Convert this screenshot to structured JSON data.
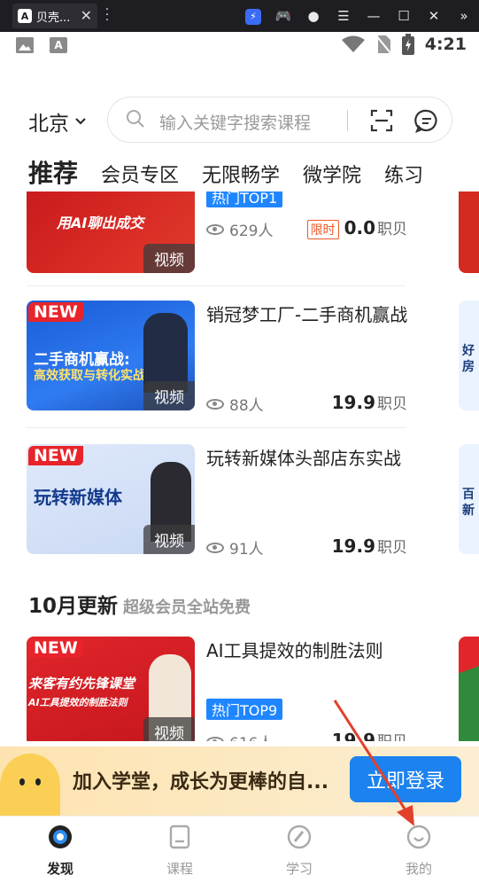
{
  "window": {
    "tab_title": "贝壳...",
    "app_logo": "A",
    "icons": [
      "flash-icon",
      "gamepad-icon",
      "account-icon",
      "menu-icon",
      "minimize-icon",
      "maximize-icon",
      "close-icon",
      "collapse-icon"
    ]
  },
  "status": {
    "time": "4:21"
  },
  "search": {
    "city": "北京",
    "placeholder": "输入关键字搜索课程"
  },
  "tabs": [
    "推荐",
    "会员专区",
    "无限畅学",
    "微学院",
    "练习"
  ],
  "courses": [
    {
      "thumb_caption": "用AI聊出成交",
      "video_label": "视频",
      "badge": "热门TOP1",
      "views": "629人",
      "limited": "限时",
      "price": "0.0",
      "unit": "职贝"
    },
    {
      "new": "NEW",
      "thumb_line1": "二手商机赢战:",
      "thumb_line2": "高效获取与转化实战",
      "video_label": "视频",
      "title": "销冠梦工厂-二手商机赢战",
      "views": "88人",
      "price": "19.9",
      "unit": "职贝"
    },
    {
      "new": "NEW",
      "thumb_line1": "玩转新媒体",
      "video_label": "视频",
      "title": "玩转新媒体头部店东实战",
      "views": "91人",
      "price": "19.9",
      "unit": "职贝"
    }
  ],
  "section": {
    "title": "10月更新",
    "subtitle": "超级会员全站免费"
  },
  "october": {
    "new": "NEW",
    "thumb_line1": "来客有约先锋课堂",
    "thumb_line2": "AI工具提效的制胜法则",
    "video_label": "视频",
    "title": "AI工具提效的制胜法则",
    "badge": "热门TOP9",
    "views": "616人",
    "price": "19.9",
    "unit": "职贝"
  },
  "peek": {
    "line1": "好",
    "line2": "房",
    "line3": "百",
    "line4": "新"
  },
  "banner": {
    "text": "加入学堂，成长为更棒的自...",
    "button": "立即登录"
  },
  "nav": [
    "发现",
    "课程",
    "学习",
    "我的"
  ],
  "colors": {
    "accent": "#1b82ef",
    "hot_badge": "#1f86ff",
    "new_badge": "#e8242a",
    "banner_bg": "#fde3b0"
  }
}
